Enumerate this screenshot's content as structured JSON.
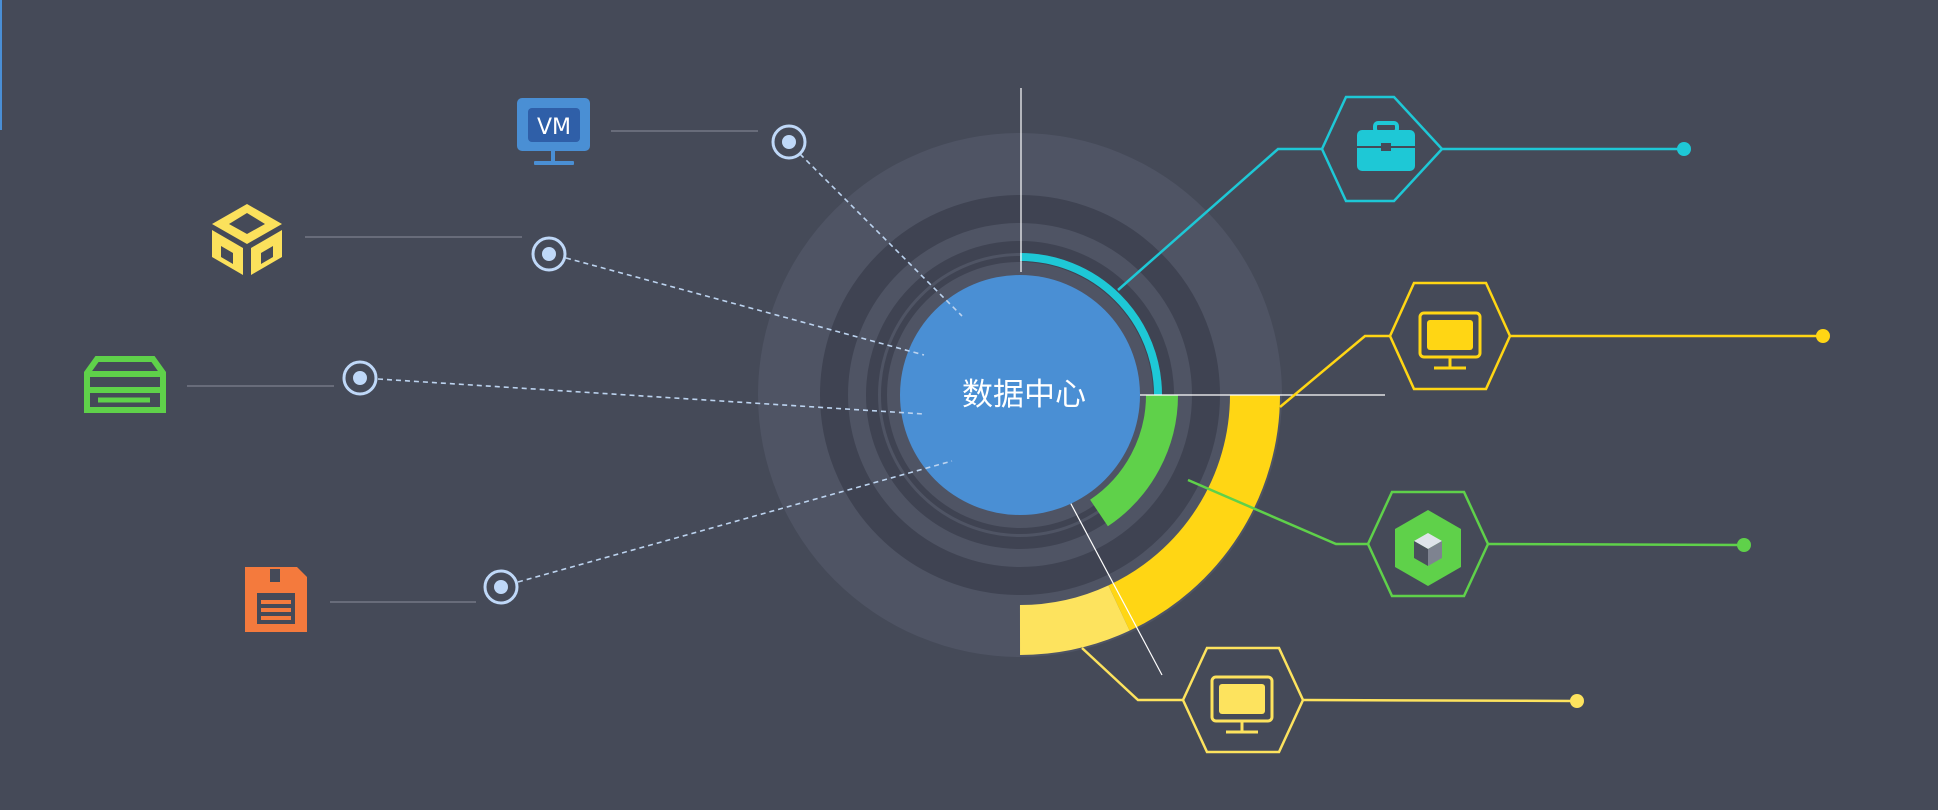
{
  "center": {
    "label": "数据中心",
    "color": "#4a8fd4"
  },
  "left_icons": [
    {
      "icon": "vm-monitor-icon",
      "text": "VM",
      "color": "#4a8fd4"
    },
    {
      "icon": "cube-blocks-icon",
      "color": "#fbe15c"
    },
    {
      "icon": "server-drawer-icon",
      "color": "#5fd14a"
    },
    {
      "icon": "floppy-disk-icon",
      "color": "#f47a3d"
    }
  ],
  "right_nodes": [
    {
      "icon": "briefcase-icon",
      "color": "#1ec8d6"
    },
    {
      "icon": "monitor-icon",
      "color": "#ffd614"
    },
    {
      "icon": "box-icon",
      "color": "#5fd14a"
    },
    {
      "icon": "monitor-icon",
      "color": "#fde35e"
    }
  ],
  "colors": {
    "background": "#454a58",
    "halo": "#4f5464",
    "ring_dark": "#3f4352",
    "cyan": "#1ec8d6",
    "green": "#5fd14a",
    "yellow": "#ffd614",
    "light_yellow": "#fde35e",
    "connector_dot": "#bfd8f8"
  }
}
